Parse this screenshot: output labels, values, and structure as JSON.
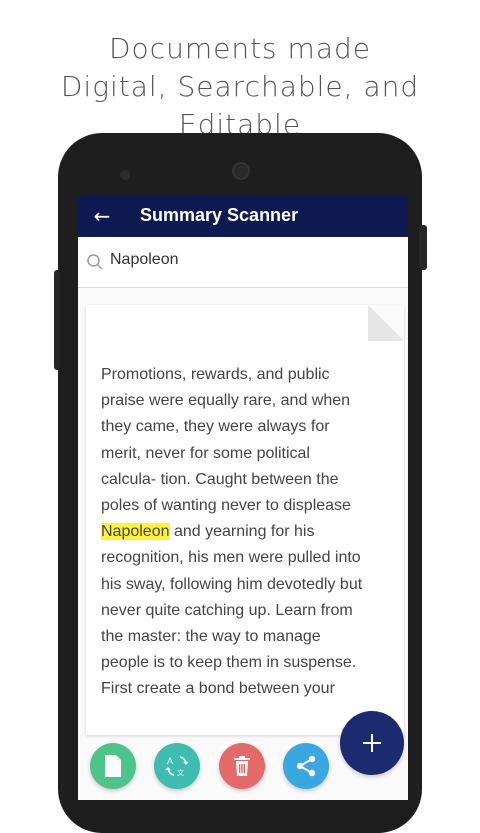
{
  "headline": {
    "line1": "Documents made",
    "line2": "Digital, Searchable, and Editable"
  },
  "app": {
    "title": "Summary Scanner",
    "back_icon": "arrow-back-icon",
    "appbar_color": "#0f1a52"
  },
  "search": {
    "value": "Napoleon",
    "icon": "search-icon"
  },
  "document": {
    "text_before": "Promotions, rewards, and public\npraise were equally rare, and when\nthey came, they were always for\nmerit, never for some political\ncalcula- tion. Caught between the\npoles of wanting never to displease\n",
    "highlight": "Napoleon",
    "text_after": " and yearning for his\nrecognition, his men were pulled into\nhis sway, following him devotedly but\nnever quite catching up. Learn from\nthe master: the way to manage\npeople is to keep them in suspense.\nFirst create a bond between your",
    "highlight_color": "#fff335"
  },
  "actions": [
    {
      "icon": "new-document-icon",
      "color": "#4cc48a"
    },
    {
      "icon": "translate-icon",
      "color": "#3dbcb0"
    },
    {
      "icon": "trash-icon",
      "color": "#e46a6a"
    },
    {
      "icon": "share-icon",
      "color": "#3aa8e0"
    },
    {
      "icon": "plus-icon",
      "color": "#1c2b70"
    }
  ]
}
